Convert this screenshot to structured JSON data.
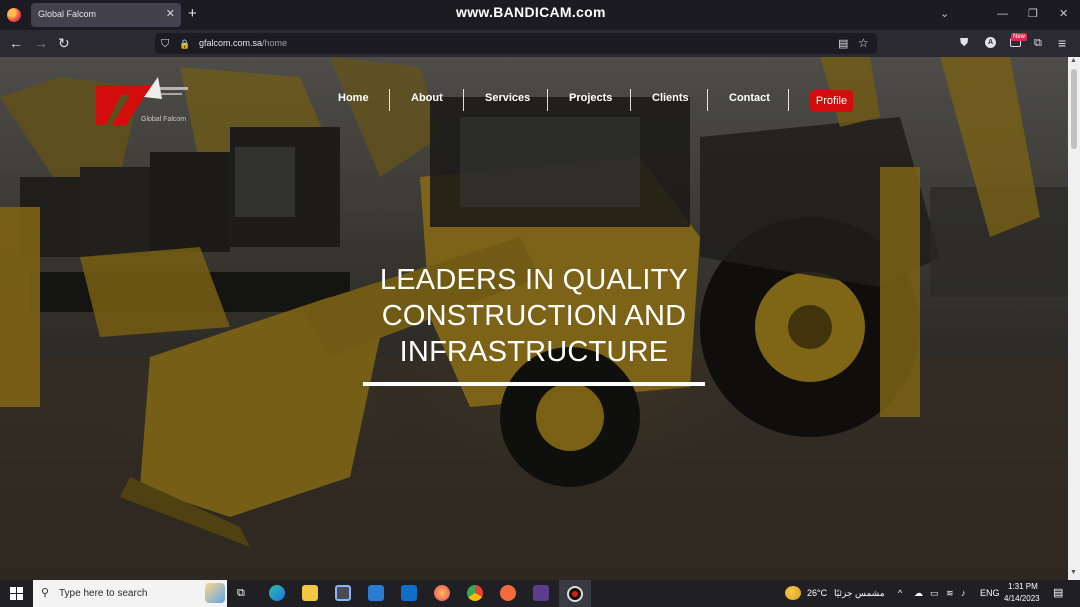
{
  "watermark": "www.BANDICAM.com",
  "browser": {
    "tab_title": "Global Falcom",
    "tab_close": "✕",
    "new_tab": "+",
    "url_host": "gfalcom.com.sa",
    "url_path": "/home",
    "badge": "New",
    "window_controls": {
      "list": "⌄",
      "minimize": "—",
      "restore": "❐",
      "close": "✕"
    }
  },
  "site": {
    "logo_caption": "Global Falcom",
    "nav": [
      "Home",
      "About",
      "Services",
      "Projects",
      "Clients",
      "Contact"
    ],
    "profile_label": "Profile",
    "hero_lines": [
      "LEADERS IN QUALITY",
      "CONSTRUCTION AND",
      "INFRASTRUCTURE"
    ],
    "brand_color": "#d30c0c"
  },
  "taskbar": {
    "search_placeholder": "Type here to search",
    "weather_temp": "26°C",
    "weather_text": "مشمس جزئيًا",
    "language": "ENG",
    "time": "1:31 PM",
    "date": "4/14/2023"
  },
  "icons": {
    "back": "←",
    "forward": "→",
    "reload": "↻",
    "shield": "⛉",
    "lock": "🔒",
    "reader": "▤",
    "star": "☆",
    "pocket": "⛊",
    "account": "A",
    "extensions": "⧉",
    "menu": "≡",
    "search": "⚲",
    "taskview": "⧉"
  }
}
